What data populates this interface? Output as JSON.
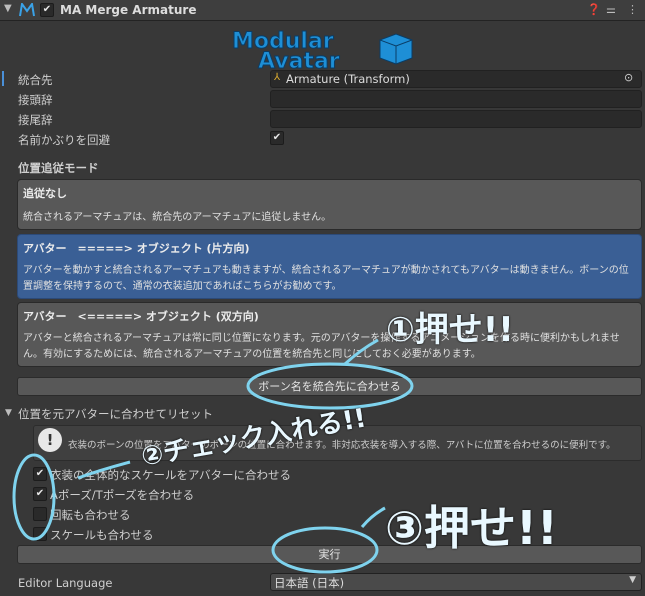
{
  "header": {
    "title": "MA Merge Armature",
    "enabled": true
  },
  "logo": {
    "line1": "Modular",
    "line2": "Avatar"
  },
  "fields": {
    "merge_target_label": "統合先",
    "merge_target_value": "Armature (Transform)",
    "prefix_label": "接頭辞",
    "prefix_value": "",
    "suffix_label": "接尾辞",
    "suffix_value": "",
    "avoid_name_collision_label": "名前かぶりを回避",
    "avoid_name_collision_checked": true
  },
  "mode": {
    "section_label": "位置追従モード",
    "options": [
      {
        "title": "追従なし",
        "desc": "統合されるアーマチュアは、統合先のアーマチュアに追従しません。",
        "selected": false
      },
      {
        "title": "アバター　=====> オブジェクト (片方向)",
        "desc": "アバターを動かすと統合されるアーマチュアも動きますが、統合されるアーマチュアが動かされてもアバターは動きません。ボーンの位置調整を保持するので、通常の衣装追加であればこちらがお勧めです。",
        "selected": true
      },
      {
        "title": "アバター　<=====> オブジェクト (双方向)",
        "desc": "アバターと統合されるアーマチュアは常に同じ位置になります。元のアバターを操作するアニメーションを作る時に便利かもしれません。有効にするためには、統合されるアーマチュアの位置を統合先と同じにしておく必要があります。",
        "selected": false
      }
    ]
  },
  "buttons": {
    "match_bone_names": "ボーン名を統合先に合わせる",
    "execute": "実行"
  },
  "reset": {
    "section_label": "位置を元アバターに合わせてリセット",
    "help_text": "衣装のボーンの位置をアバターのボーンの位置に合わせます。非対応衣装を導入する際、アバトに位置を合わせるのに便利です。",
    "options": [
      {
        "label": "衣装の全体的なスケールをアバターに合わせる",
        "checked": true
      },
      {
        "label": "Aポーズ/Tポーズを合わせる",
        "checked": true
      },
      {
        "label": "回転も合わせる",
        "checked": false
      },
      {
        "label": "スケールも合わせる",
        "checked": false
      }
    ]
  },
  "language": {
    "label": "Editor Language",
    "value": "日本語 (日本)"
  },
  "annotations": {
    "step1": "①押せ!!",
    "step2": "②チェック入れる!!",
    "step3": "③押せ!!"
  },
  "colors": {
    "background": "#383838",
    "selected": "#3a5f95",
    "annotation": "#7fd3ee",
    "logo": "#1e8fd6"
  }
}
